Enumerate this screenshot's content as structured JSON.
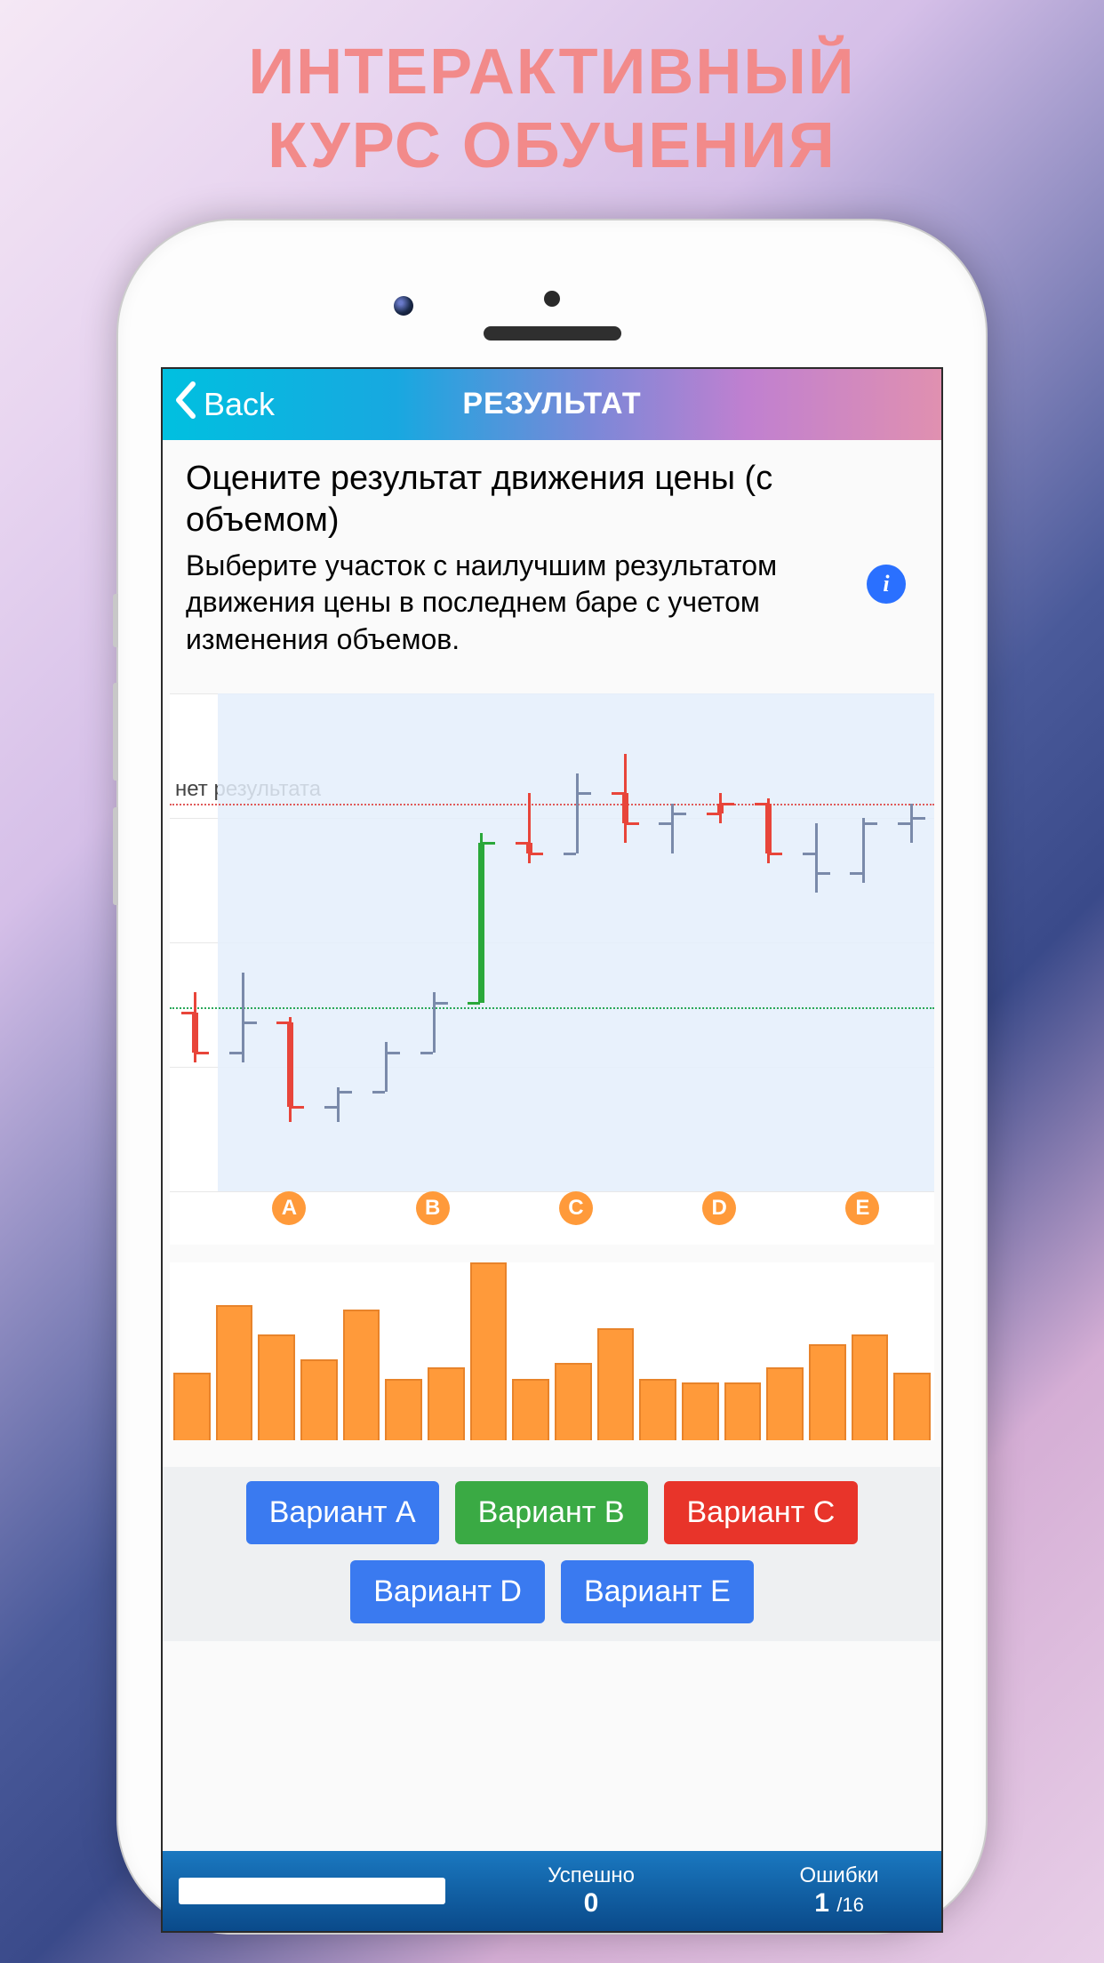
{
  "promo": {
    "line1": "ИНТЕРАКТИВНЫЙ",
    "line2": "КУРС ОБУЧЕНИЯ"
  },
  "navbar": {
    "back_label": "Back",
    "title": "РЕЗУЛЬТАТ"
  },
  "question": {
    "title": "Оцените результат движения цены (с объемом)",
    "description": "Выберите участок с наилучшим результатом движения цены в последнем баре с учетом изменения объемов."
  },
  "chart": {
    "no_result_label": "нет результата",
    "ref_red_y": 78,
    "ref_green_y": 37,
    "y_range": [
      0,
      100
    ],
    "bands": [
      {
        "letter": "A",
        "start": 1,
        "end": 3
      },
      {
        "letter": "B",
        "start": 4,
        "end": 6
      },
      {
        "letter": "C",
        "start": 7,
        "end": 9
      },
      {
        "letter": "D",
        "start": 10,
        "end": 12
      },
      {
        "letter": "E",
        "start": 13,
        "end": 15
      }
    ]
  },
  "chart_data": {
    "type": "bar",
    "title": "",
    "xlabel": "",
    "ylabel": "",
    "series": [
      {
        "name": "price-ohlc",
        "bars": [
          {
            "i": 0,
            "open": 36,
            "high": 40,
            "low": 26,
            "close": 28,
            "color": "red"
          },
          {
            "i": 1,
            "open": 28,
            "high": 44,
            "low": 26,
            "close": 34,
            "color": "gray"
          },
          {
            "i": 2,
            "open": 34,
            "high": 35,
            "low": 14,
            "close": 17,
            "color": "red"
          },
          {
            "i": 3,
            "open": 17,
            "high": 21,
            "low": 14,
            "close": 20,
            "color": "gray"
          },
          {
            "i": 4,
            "open": 20,
            "high": 30,
            "low": 20,
            "close": 28,
            "color": "gray"
          },
          {
            "i": 5,
            "open": 28,
            "high": 40,
            "low": 28,
            "close": 38,
            "color": "gray"
          },
          {
            "i": 6,
            "open": 38,
            "high": 72,
            "low": 38,
            "close": 70,
            "color": "green"
          },
          {
            "i": 7,
            "open": 70,
            "high": 80,
            "low": 66,
            "close": 68,
            "color": "red"
          },
          {
            "i": 8,
            "open": 68,
            "high": 84,
            "low": 68,
            "close": 80,
            "color": "gray"
          },
          {
            "i": 9,
            "open": 80,
            "high": 88,
            "low": 70,
            "close": 74,
            "color": "red"
          },
          {
            "i": 10,
            "open": 74,
            "high": 78,
            "low": 68,
            "close": 76,
            "color": "gray"
          },
          {
            "i": 11,
            "open": 76,
            "high": 80,
            "low": 74,
            "close": 78,
            "color": "red"
          },
          {
            "i": 12,
            "open": 78,
            "high": 79,
            "low": 66,
            "close": 68,
            "color": "red"
          },
          {
            "i": 13,
            "open": 68,
            "high": 74,
            "low": 60,
            "close": 64,
            "color": "gray"
          },
          {
            "i": 14,
            "open": 64,
            "high": 75,
            "low": 62,
            "close": 74,
            "color": "gray"
          },
          {
            "i": 15,
            "open": 74,
            "high": 78,
            "low": 70,
            "close": 75,
            "color": "gray"
          }
        ]
      },
      {
        "name": "volume",
        "values": [
          35,
          70,
          55,
          42,
          68,
          32,
          38,
          92,
          32,
          40,
          58,
          32,
          30,
          30,
          38,
          50,
          55,
          35
        ]
      }
    ]
  },
  "options": [
    {
      "label": "Вариант A",
      "style": "blue"
    },
    {
      "label": "Вариант B",
      "style": "green"
    },
    {
      "label": "Вариант C",
      "style": "red"
    },
    {
      "label": "Вариант D",
      "style": "blue"
    },
    {
      "label": "Вариант E",
      "style": "blue"
    }
  ],
  "status": {
    "progress_pct": 0,
    "success_label": "Успешно",
    "success_value": "0",
    "errors_label": "Ошибки",
    "errors_value": "1",
    "errors_total": "/16"
  }
}
